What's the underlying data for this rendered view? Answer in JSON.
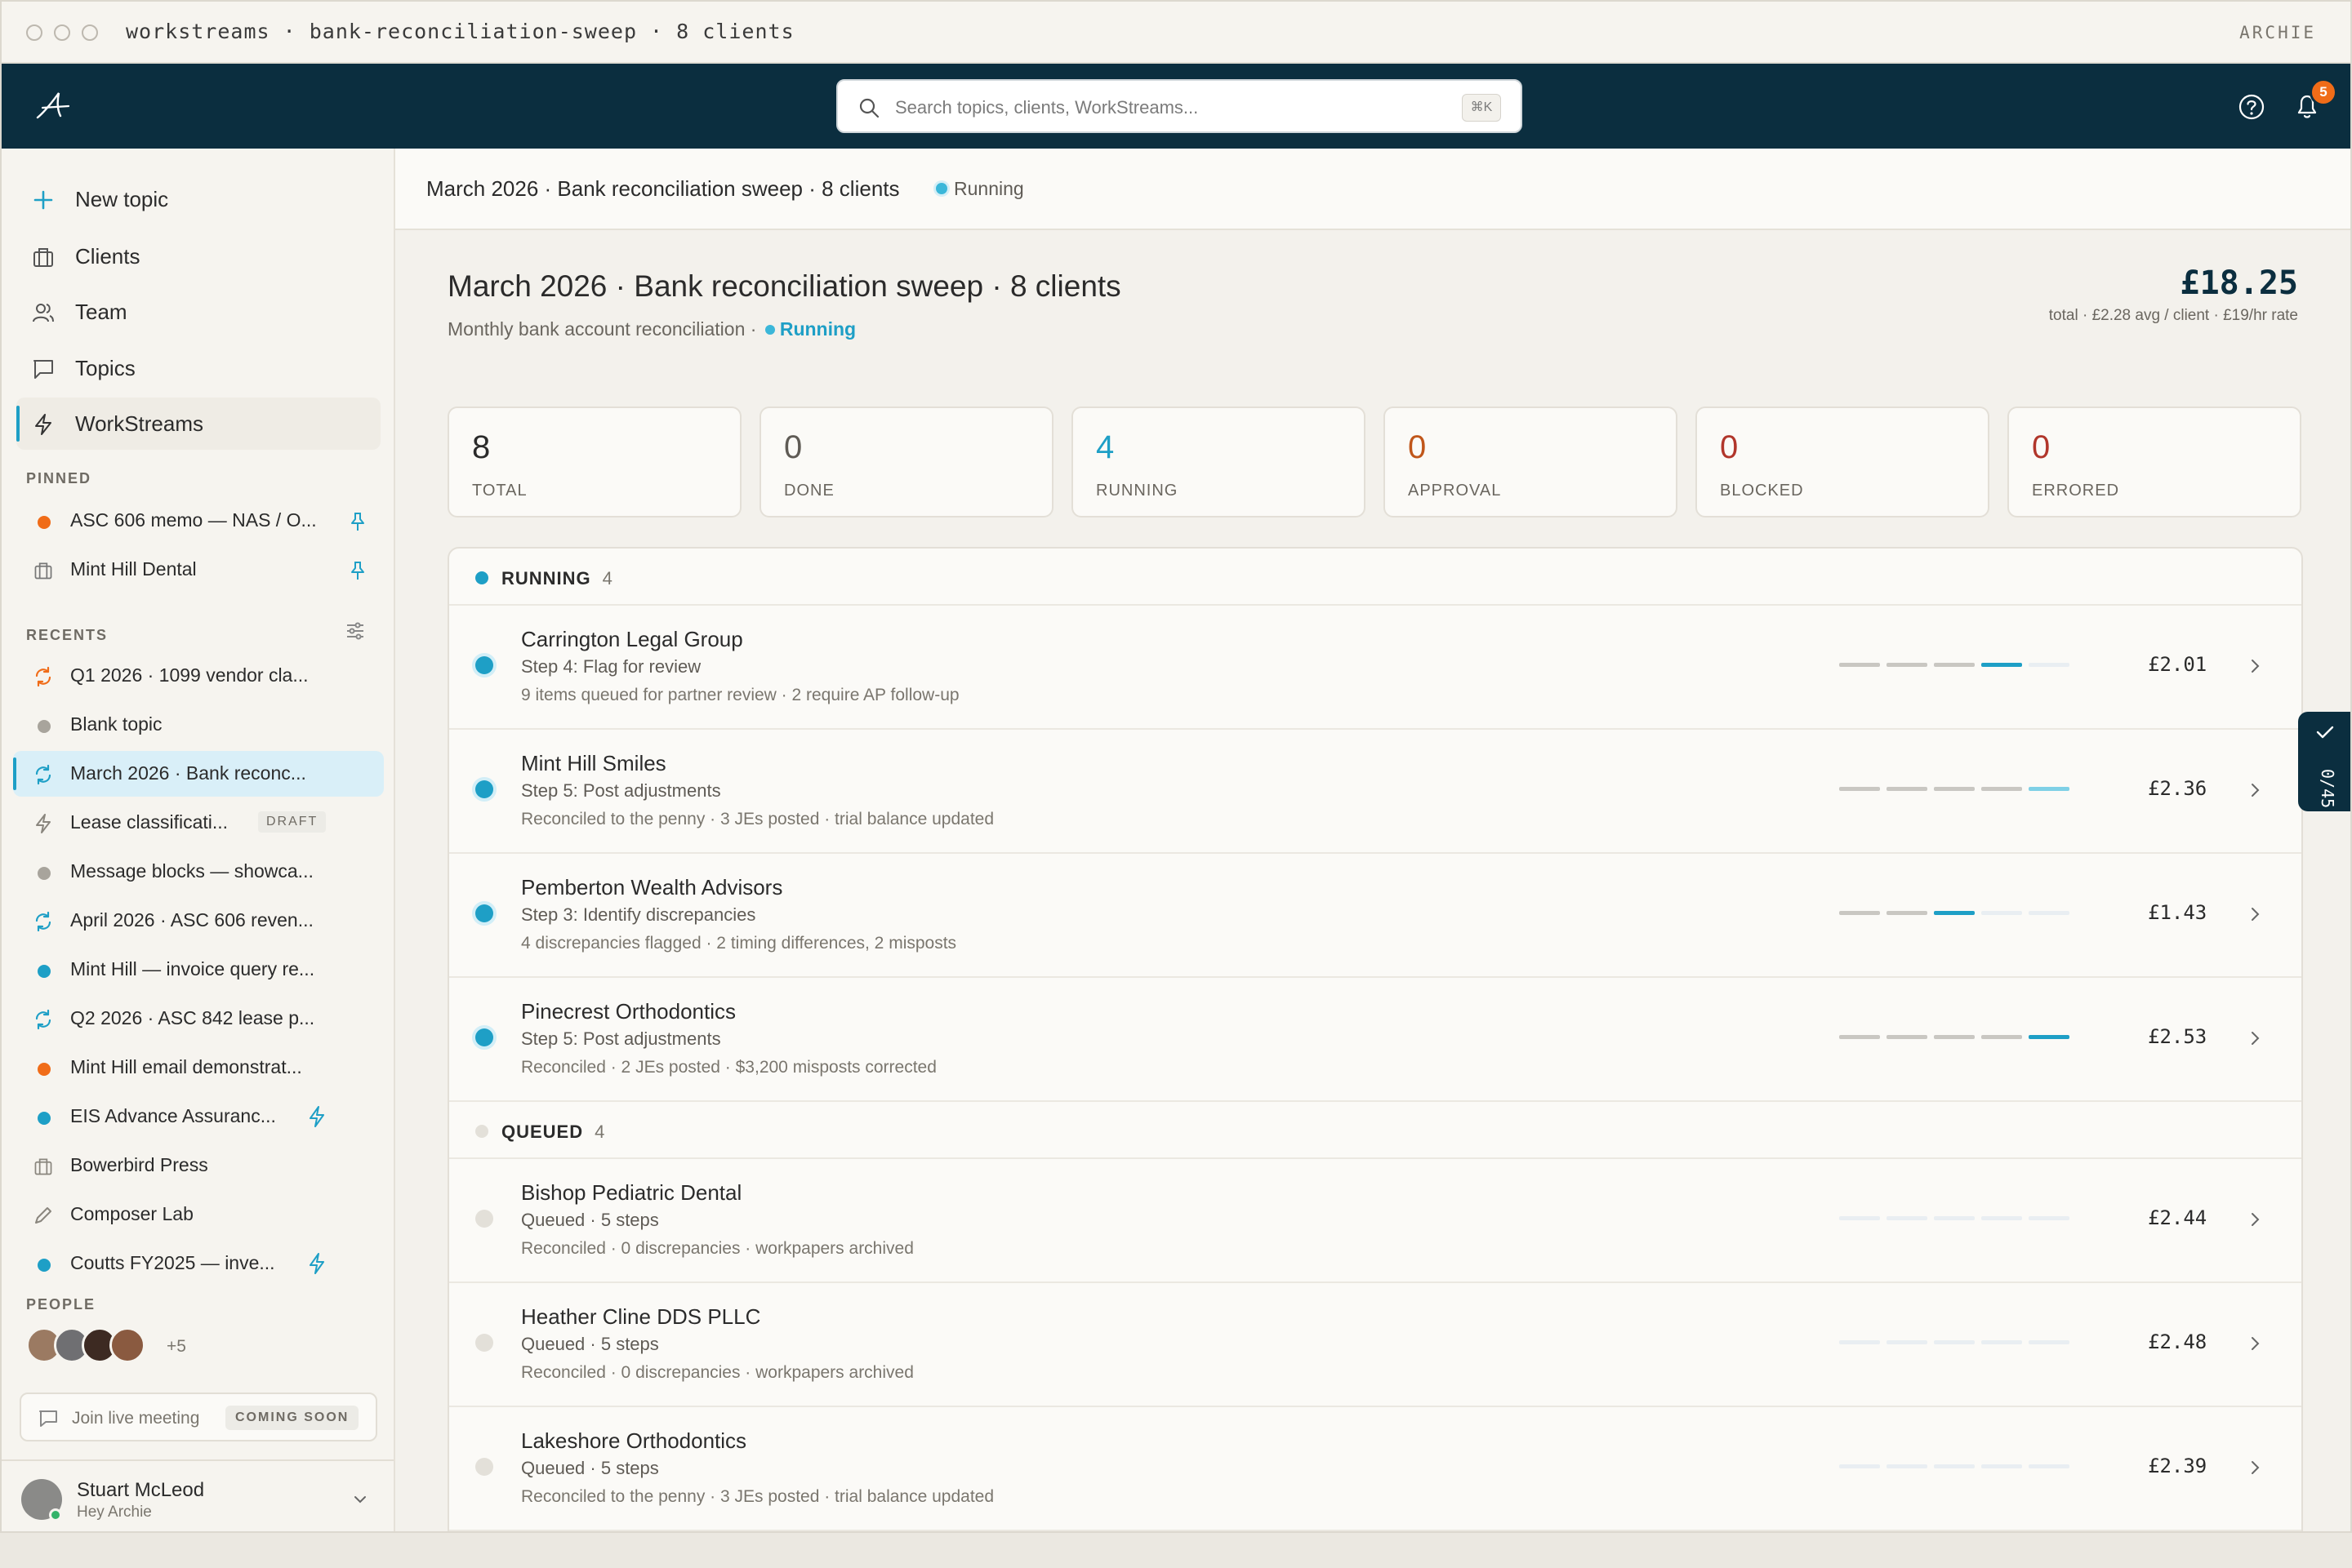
{
  "window": {
    "title": "workstreams · bank-reconciliation-sweep · 8 clients",
    "user": "ARCHIE"
  },
  "header": {
    "search_placeholder": "Search topics, clients, WorkStreams...",
    "search_shortcut": "⌘K",
    "notifications": "5",
    "brand_color": "#0b2e3f",
    "accent_color": "#1e9fc6"
  },
  "sidebar": {
    "nav": [
      "New topic",
      "Clients",
      "Team",
      "Topics",
      "WorkStreams"
    ],
    "pinned_label": "PINNED",
    "pinned": [
      "ASC 606 memo — NAS / O...",
      "Mint Hill Dental"
    ],
    "recents_label": "RECENTS",
    "recents": [
      {
        "label": "Q1 2026 · 1099 vendor cla...",
        "icon": "sync-icon",
        "color": "#f06c18"
      },
      {
        "label": "Blank topic",
        "icon": "dot",
        "color": "#a8a49c"
      },
      {
        "label": "March 2026 · Bank reconc...",
        "icon": "sync-icon",
        "color": "#1e9fc6"
      },
      {
        "label": "Lease classificati...",
        "icon": "bolt-icon",
        "color": "#8a867e",
        "tag": "DRAFT"
      },
      {
        "label": "Message blocks — showca...",
        "icon": "dot",
        "color": "#a8a49c"
      },
      {
        "label": "April 2026 · ASC 606 reven...",
        "icon": "sync-icon",
        "color": "#1e9fc6"
      },
      {
        "label": "Mint Hill — invoice query re...",
        "icon": "dot",
        "color": "#1e9fc6"
      },
      {
        "label": "Q2 2026 · ASC 842 lease p...",
        "icon": "sync-icon",
        "color": "#1e9fc6"
      },
      {
        "label": "Mint Hill email demonstrat...",
        "icon": "dot",
        "color": "#f06c18"
      },
      {
        "label": "EIS Advance Assuranc...",
        "icon": "dot",
        "color": "#1e9fc6"
      },
      {
        "label": "Bowerbird Press",
        "icon": "building-icon",
        "color": "#8a867e"
      },
      {
        "label": "Composer Lab",
        "icon": "pencil-icon",
        "color": "#8a867e"
      },
      {
        "label": "Coutts FY2025 — inve...",
        "icon": "dot",
        "color": "#1e9fc6"
      }
    ],
    "people_label": "PEOPLE",
    "people_more": "+5",
    "live_meeting": "Join live meeting",
    "coming_soon": "COMING SOON",
    "user": {
      "name": "Stuart McLeod",
      "subtitle": "Hey Archie"
    }
  },
  "main": {
    "breadcrumb": "March 2026 · Bank reconciliation sweep · 8 clients",
    "breadcrumb_status": "Running",
    "title": "March 2026 · Bank reconciliation sweep · 8 clients",
    "subtitle": "Monthly bank account reconciliation",
    "status": "Running",
    "total_cost": "£18.25",
    "total_note": "total · £2.28 avg / client · £19/hr rate",
    "stats": [
      {
        "n": "8",
        "label": "TOTAL",
        "color": "#2b2b2b"
      },
      {
        "n": "0",
        "label": "DONE",
        "color": "#5f5b55"
      },
      {
        "n": "4",
        "label": "RUNNING",
        "color": "#1e9fc6"
      },
      {
        "n": "0",
        "label": "APPROVAL",
        "color": "#c0561a"
      },
      {
        "n": "0",
        "label": "BLOCKED",
        "color": "#b1362b"
      },
      {
        "n": "0",
        "label": "ERRORED",
        "color": "#b1362b"
      }
    ],
    "groups": [
      {
        "label": "RUNNING",
        "count": "4"
      },
      {
        "label": "QUEUED",
        "count": "4"
      }
    ],
    "rows": [
      {
        "name": "Carrington Legal Group",
        "step": "Step 4: Flag for review",
        "detail": "9 items queued for partner review · 2 require AP follow-up",
        "cost": "£2.01",
        "done": 3,
        "current": 4,
        "total": 5
      },
      {
        "name": "Mint Hill Smiles",
        "step": "Step 5: Post adjustments",
        "detail": "Reconciled to the penny · 3 JEs posted · trial balance updated",
        "cost": "£2.36",
        "done": 4,
        "current": 5,
        "total": 5
      },
      {
        "name": "Pemberton Wealth Advisors",
        "step": "Step 3: Identify discrepancies",
        "detail": "4 discrepancies flagged · 2 timing differences, 2 misposts",
        "cost": "£1.43",
        "done": 2,
        "current": 3,
        "total": 5
      },
      {
        "name": "Pinecrest Orthodontics",
        "step": "Step 5: Post adjustments",
        "detail": "Reconciled · 2 JEs posted · $3,200 misposts corrected",
        "cost": "£2.53",
        "done": 4,
        "current": 5,
        "total": 5
      },
      {
        "name": "Bishop Pediatric Dental",
        "step": "Queued · 5 steps",
        "detail": "Reconciled · 0 discrepancies · workpapers archived",
        "cost": "£2.44",
        "done": 0,
        "current": 0,
        "total": 5
      },
      {
        "name": "Heather Cline DDS PLLC",
        "step": "Queued · 5 steps",
        "detail": "Reconciled · 0 discrepancies · workpapers archived",
        "cost": "£2.48",
        "done": 0,
        "current": 0,
        "total": 5
      },
      {
        "name": "Lakeshore Orthodontics",
        "step": "Queued · 5 steps",
        "detail": "Reconciled to the penny · 3 JEs posted · trial balance updated",
        "cost": "£2.39",
        "done": 0,
        "current": 0,
        "total": 5
      }
    ],
    "progress_tab": "0/45"
  }
}
